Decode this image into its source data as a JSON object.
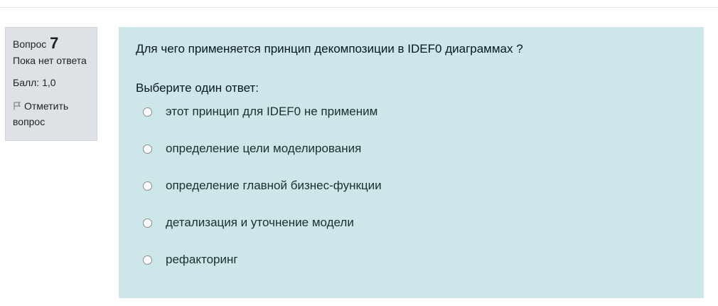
{
  "info": {
    "question_label": "Вопрос",
    "question_number": "7",
    "state": "Пока нет ответа",
    "grade": "Балл: 1,0",
    "flag_label": "Отметить вопрос"
  },
  "question": {
    "text": "Для чего применяется принцип декомпозиции в IDEF0 диаграммах ?",
    "prompt": "Выберите один ответ:",
    "answers": [
      {
        "label": "этот принцип для IDEF0 не применим",
        "selected": false
      },
      {
        "label": "определение цели моделирования",
        "selected": false
      },
      {
        "label": "определение главной бизнес-функции",
        "selected": false
      },
      {
        "label": "детализация и уточнение модели",
        "selected": false
      },
      {
        "label": "рефакторинг",
        "selected": false
      }
    ]
  },
  "colors": {
    "info_bg": "#dee2e6",
    "content_bg": "#cce6ea",
    "text": "#001a1e"
  },
  "icons": {
    "flag": "flag-icon"
  }
}
